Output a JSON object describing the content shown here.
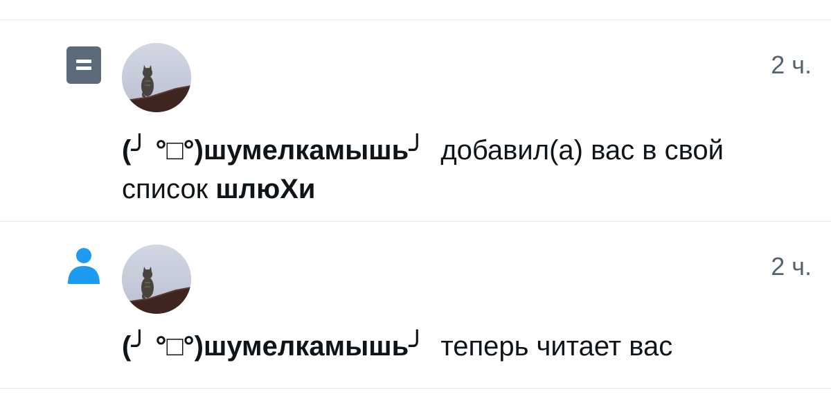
{
  "notifications": [
    {
      "type_icon": "list-icon",
      "time": "2 ч.",
      "user_name": "(╯ °□°)шумелкамышь╯",
      "action": "добавил(а) вас в свой список",
      "list_name": "шлюХи",
      "accent_color": "#5b6b7a"
    },
    {
      "type_icon": "person-icon",
      "time": "2 ч.",
      "user_name": "(╯ °□°)шумелкамышь╯",
      "action": "теперь читает вас",
      "accent_color": "#1d9bf0"
    }
  ]
}
